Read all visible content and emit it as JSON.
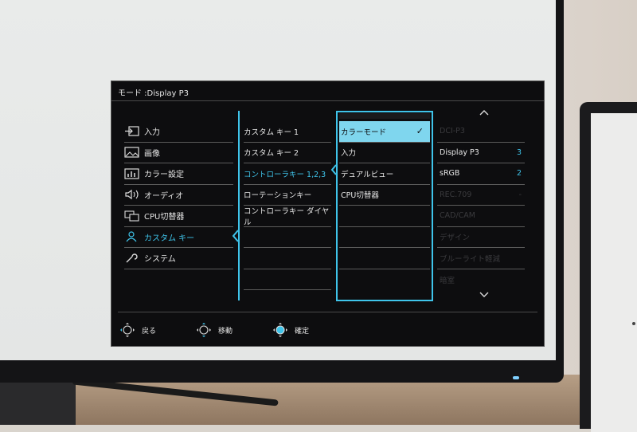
{
  "osd": {
    "title": "モード :Display P3",
    "main_menu": [
      {
        "label": "入力",
        "icon": "input-icon"
      },
      {
        "label": "画像",
        "icon": "picture-icon"
      },
      {
        "label": "カラー設定",
        "icon": "color-settings-icon"
      },
      {
        "label": "オーディオ",
        "icon": "audio-icon"
      },
      {
        "label": "CPU切替器",
        "icon": "kvm-icon"
      },
      {
        "label": "カスタム キー",
        "icon": "person-icon",
        "selected": true
      },
      {
        "label": "システム",
        "icon": "wrench-icon"
      }
    ],
    "submenu": [
      {
        "label": "カスタム キー 1"
      },
      {
        "label": "カスタム キー 2"
      },
      {
        "label": "コントローラキー 1,2,3",
        "selected": true
      },
      {
        "label": "ローテーションキー"
      },
      {
        "label": "コントローラキー ダイヤル"
      }
    ],
    "options": [
      {
        "label": "カラーモード",
        "highlighted": true,
        "check": "✓"
      },
      {
        "label": "入力"
      },
      {
        "label": "デュアルビュー"
      },
      {
        "label": "CPU切替器"
      }
    ],
    "values": [
      {
        "label": "DCI-P3",
        "num": "",
        "dim": true
      },
      {
        "label": "Display P3",
        "num": "3"
      },
      {
        "label": "sRGB",
        "num": "2"
      },
      {
        "label": "REC.709",
        "num": "-",
        "dim": true
      },
      {
        "label": "CAD/CAM",
        "num": "",
        "dim": true
      },
      {
        "label": "デザイン",
        "num": "",
        "dim": true
      },
      {
        "label": "ブルーライト軽減",
        "num": "",
        "dim": true
      },
      {
        "label": "暗室",
        "num": "",
        "dim": true
      }
    ],
    "footer": {
      "back": "戻る",
      "move": "移動",
      "confirm": "確定"
    },
    "accent_color": "#3fc4ea"
  }
}
